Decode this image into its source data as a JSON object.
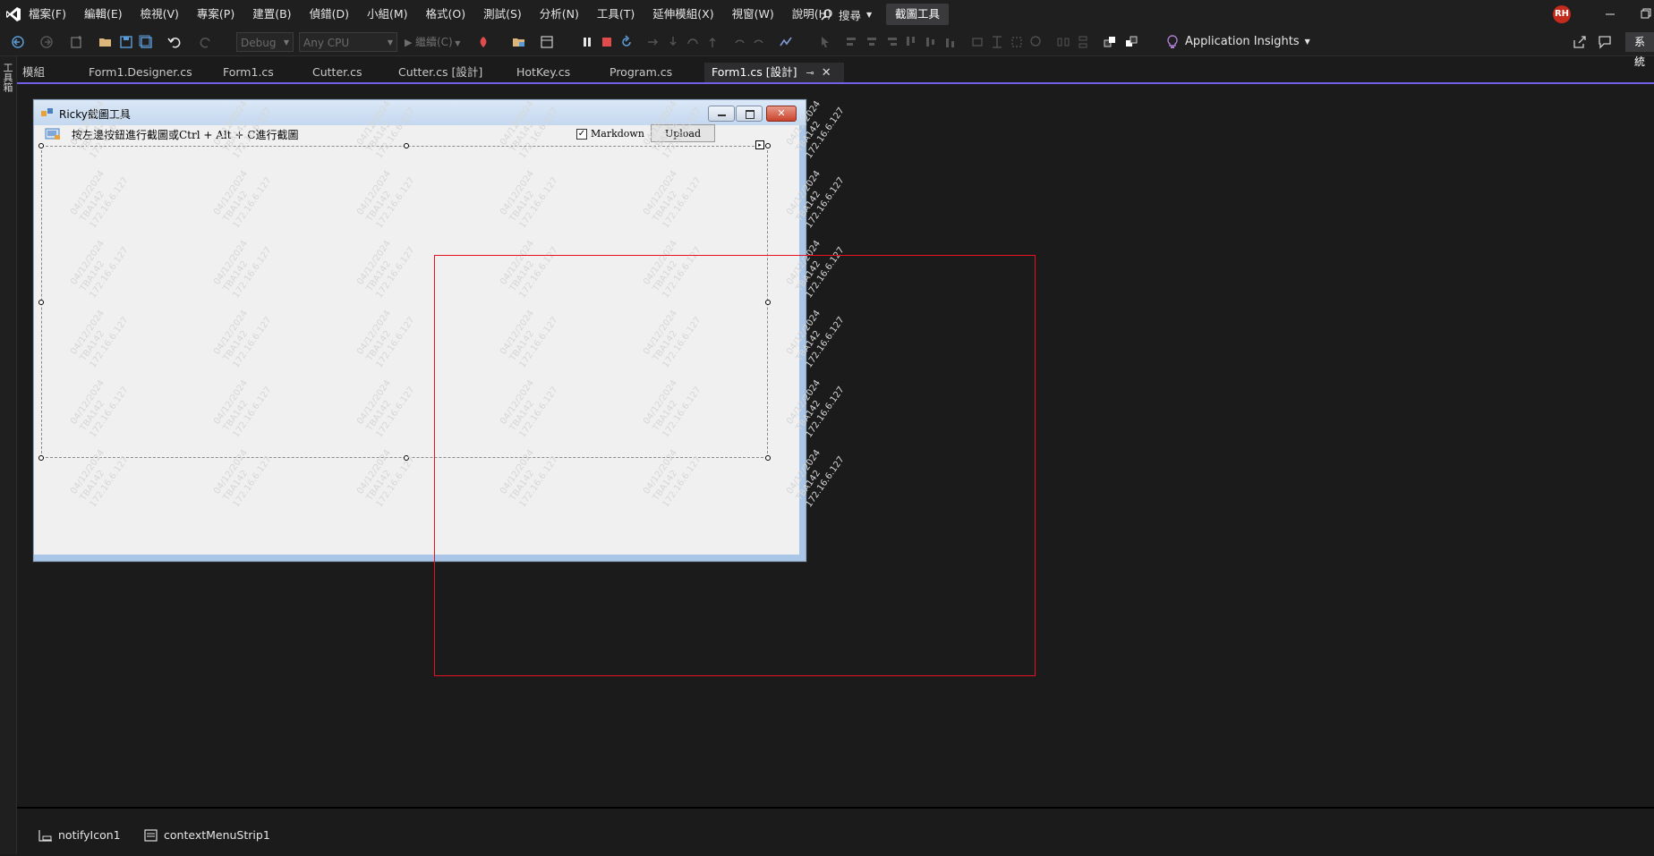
{
  "menu": {
    "items": [
      "檔案(F)",
      "編輯(E)",
      "檢視(V)",
      "專案(P)",
      "建置(B)",
      "偵錯(D)",
      "小組(M)",
      "格式(O)",
      "測試(S)",
      "分析(N)",
      "工具(T)",
      "延伸模組(X)",
      "視窗(W)",
      "說明(H)"
    ],
    "search_label": "搜尋",
    "solution_name": "截圖工具",
    "avatar_initials": "RH"
  },
  "toolbar": {
    "config_value": "Debug",
    "platform_value": "Any CPU",
    "continue_label": "繼續(C)",
    "app_insights_label": "Application Insights",
    "system_button_label": "系統"
  },
  "left_strip": {
    "toolbox_label": "工具箱"
  },
  "tabs": [
    {
      "label": "模組"
    },
    {
      "label": "Form1.Designer.cs"
    },
    {
      "label": "Form1.cs"
    },
    {
      "label": "Cutter.cs"
    },
    {
      "label": "Cutter.cs [設計]"
    },
    {
      "label": "HotKey.cs"
    },
    {
      "label": "Program.cs"
    },
    {
      "label": "Form1.cs [設計]",
      "active": true
    }
  ],
  "winform": {
    "title": "Ricky截圖工具",
    "hint_text": "按左邊按鈕進行截圖或Ctrl + Alt + C進行截圖",
    "checkbox_label": "Markdown",
    "checkbox_checked": true,
    "upload_label": "Upload",
    "watermark_lines": [
      "04/12/2024",
      "TBA142",
      "172.16.6.127"
    ]
  },
  "tray": {
    "items": [
      "notifyIcon1",
      "contextMenuStrip1"
    ]
  },
  "colors": {
    "accent": "#7160e8",
    "selection_rect": "#e81123",
    "background": "#1b1b1c"
  }
}
